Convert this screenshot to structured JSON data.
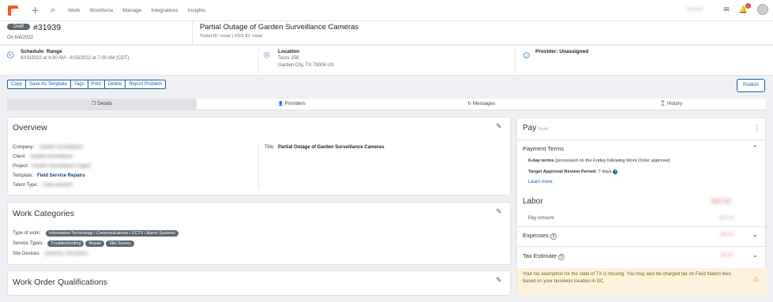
{
  "nav": {
    "items": [
      "Work",
      "Workforce",
      "Manage",
      "Integrations",
      "Insights"
    ],
    "user_blurred": "Account"
  },
  "header": {
    "status": "Draft",
    "wo_number": "#31939",
    "on_date": "On 6/6/2022",
    "title": "Partial Outage of Garden Surveillance Cameras",
    "ticket": "Ticket ID: none  |  VGS ID: none"
  },
  "schedule": {
    "label": "Schedule: Range",
    "value": "6/15/2022 at 4:30 AM  -  6/15/2022 at 7:30 AM  (CDT)"
  },
  "location": {
    "label": "Location",
    "line1": "Tours 158",
    "line2": "Garden City, TX 78006 US"
  },
  "provider": {
    "label": "Provider: Unassigned"
  },
  "toolbar": [
    "Copy",
    "Save As Template",
    "Tags",
    "Print",
    "Delete",
    "Report Problem"
  ],
  "publish_label": "Publish",
  "tabs": [
    {
      "icon": "❐",
      "label": "Details"
    },
    {
      "icon": "👤",
      "label": "Providers"
    },
    {
      "icon": "↻",
      "label": "Messages"
    },
    {
      "icon": "⌛",
      "label": "History"
    }
  ],
  "overview": {
    "title": "Overview",
    "company_label": "Company:",
    "client_label": "Client:",
    "project_label": "Project:",
    "template_label": "Template:",
    "template_value": "Field Service Repairs",
    "talent_label": "Talent Type:",
    "title_label": "Title:",
    "title_value": "Partial Outage of Garden Surveillance Cameras",
    "blur_company": "Garden Surveillance",
    "blur_client": "Garden Surveillance",
    "blur_project": "Garden Surveillance Project",
    "blur_talent": "Field Services"
  },
  "work_categories": {
    "title": "Work Categories",
    "type_label": "Type of work:",
    "type_value": "Information Technology / Communications / CCTV / Alarm Systems",
    "service_label": "Service Types:",
    "services": [
      "Troubleshooting",
      "Repair",
      "Site Survey"
    ],
    "devices_label": "Site Devices:",
    "devices_blur": "Cameras, Recorders"
  },
  "qualifications": {
    "title": "Work Order Qualifications"
  },
  "pay": {
    "title": "Pay",
    "sub": "Fixed",
    "payment_terms_title": "Payment Terms",
    "terms_bold": "0-day terms",
    "terms_rest": " (processed on the Friday following Work Order approval)",
    "approval_bold": "Target Approval Review Period:",
    "approval_rest": " 7 days",
    "learn_more": "Learn more",
    "labor_title": "Labor",
    "labor_amount_blur": "$00.00",
    "pay_amount_label": "Pay Amount",
    "pay_amount_blur": "$00.00",
    "expenses_label": "Expenses",
    "expenses_blur": "$0.00",
    "tax_label": "Tax Estimate",
    "tax_blur": "$0.00",
    "warning": "Your tax exemption for the state of TX is missing. You may also be charged tax on Field Nation fees based on your business location in DC."
  },
  "colors": {
    "brand": "#f15a24",
    "accent": "#1a5fb4",
    "pill": "#5c6770",
    "warning_bg": "#fdf3dc"
  }
}
